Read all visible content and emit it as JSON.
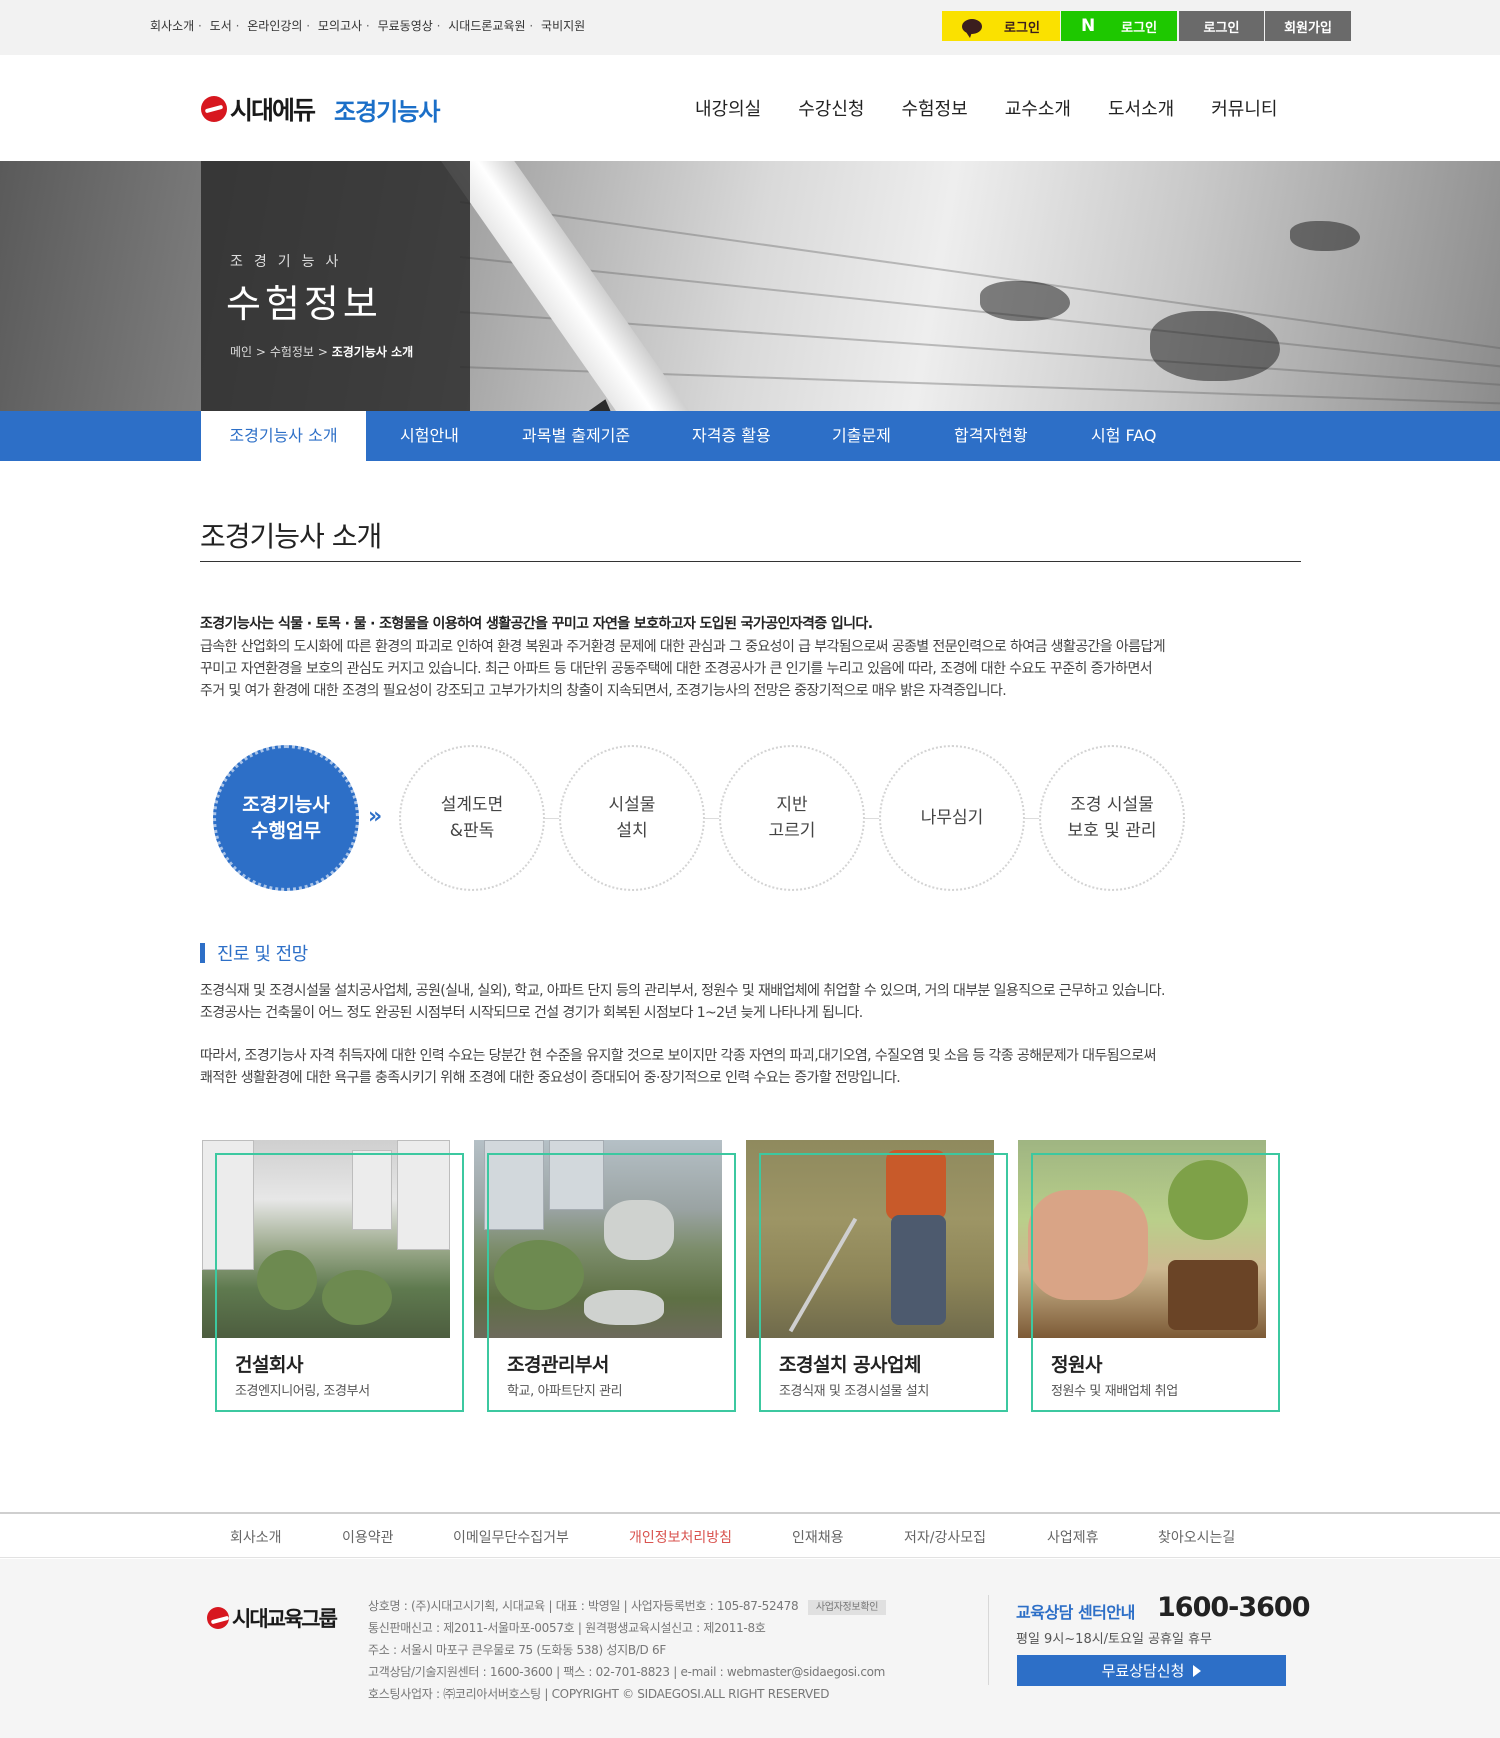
{
  "top_util": {
    "links": [
      "회사소개",
      "도서",
      "온라인강의",
      "모의고사",
      "무료동영상",
      "시대드론교육원",
      "국비지원"
    ],
    "kakao_login": "로그인",
    "naver_login": "로그인",
    "naver_mark": "N",
    "login": "로그인",
    "join": "회원가입"
  },
  "header": {
    "logo_text": "시대에듀",
    "logo_sub": "조경기능사",
    "nav": [
      "내강의실",
      "수강신청",
      "수험정보",
      "교수소개",
      "도서소개",
      "커뮤니티"
    ]
  },
  "hero": {
    "small_title": "조경기능사",
    "title": "수험정보",
    "breadcrumb_home": "메인",
    "breadcrumb_mid": "수험정보",
    "breadcrumb_current": "조경기능사 소개",
    "breadcrumb_sep": ">"
  },
  "subnav": {
    "tabs": [
      "조경기능사 소개",
      "시험안내",
      "과목별 출제기준",
      "자격증 활용",
      "기출문제",
      "합격자현황",
      "시험 FAQ"
    ]
  },
  "page": {
    "title": "조경기능사 소개",
    "intro_lead": "조경기능사는 식물 · 토목 · 물 · 조형물을 이용하여 생활공간을 꾸미고 자연을 보호하고자 도입된 국가공인자격증 입니다.",
    "intro_lines": [
      "급속한 산업화의 도시화에 따른 환경의 파괴로 인하여 환경 복원과 주거환경 문제에 대한 관심과 그 중요성이 급 부각됨으로써 공종별 전문인력으로 하여금 생활공간을 아름답게",
      "꾸미고 자연환경을 보호의 관심도 커지고 있습니다. 최근 아파트 등 대단위 공동주택에 대한 조경공사가 큰 인기를 누리고 있음에 따라, 조경에 대한 수요도 꾸준히 증가하면서",
      "주거 및 여가 환경에 대한 조경의 필요성이 강조되고 고부가가치의 창출이 지속되면서, 조경기능사의 전망은 중장기적으로 매우 밝은 자격증입니다."
    ]
  },
  "duties": {
    "main": "조경기능사\n수행업무",
    "arrow": "»",
    "items": [
      "설계도면\n&판독",
      "시설물\n설치",
      "지반\n고르기",
      "나무심기",
      "조경 시설물\n보호 및 관리"
    ]
  },
  "career": {
    "heading": "진로 및 전망",
    "para1": [
      "조경식재 및 조경시설물 설치공사업체, 공원(실내, 실외), 학교, 아파트 단지 등의 관리부서, 정원수 및 재배업체에 취업할 수 있으며, 거의 대부분 일용직으로 근무하고 있습니다.",
      "조경공사는 건축물이 어느 정도 완공된 시점부터 시작되므로 건설 경기가 회복된 시점보다 1~2년 늦게 나타나게 됩니다."
    ],
    "para2": [
      "따라서, 조경기능사 자격 취득자에 대한 인력 수요는 당분간 현 수준을 유지할 것으로 보이지만 각종 자연의 파괴,대기오염, 수질오염 및 소음 등 각종 공해문제가 대두됨으로써",
      "쾌적한 생활환경에 대한 욕구를 충족시키기 위해 조경에 대한 중요성이 증대되어 중·장기적으로 인력 수요는 증가할 전망입니다."
    ]
  },
  "cards": [
    {
      "title": "건설회사",
      "desc": "조경엔지니어링, 조경부서"
    },
    {
      "title": "조경관리부서",
      "desc": "학교, 아파트단지 관리"
    },
    {
      "title": "조경설치 공사업체",
      "desc": "조경식재 및 조경시설물 설치"
    },
    {
      "title": "정원사",
      "desc": "정원수 및 재배업체 취업"
    }
  ],
  "footer": {
    "links": [
      "회사소개",
      "이용약관",
      "이메일무단수집거부",
      "개인정보처리방침",
      "인재채용",
      "저자/강사모집",
      "사업제휴",
      "찾아오시는길"
    ],
    "logo_text": "시대교육그룹",
    "info_lines": [
      "상호명 : (주)시대고시기획, 시대교육 | 대표 : 박영일 | 사업자등록번호 : 105-87-52478",
      "통신판매신고 : 제2011-서울마포-0057호 | 원격평생교육시설신고 : 제2011-8호",
      "주소 : 서울시 마포구 큰우물로 75 (도화동 538) 성지B/D 6F",
      "고객상담/기술지원센터 : 1600-3600 | 팩스 : 02-701-8823 | e-mail : webmaster@sidaegosi.com",
      "호스팅사업자 : ㈜코리아서버호스팅 | COPYRIGHT © SIDAEGOSI.ALL RIGHT RESERVED"
    ],
    "badge": "사업자정보확인",
    "call_label": "교육상담 센터안내",
    "call_number": "1600-3600",
    "hours": "평일 9시~18시/토요일 공휴일 휴무",
    "consult_button": "무료상담신청"
  },
  "colors": {
    "primary": "#2d6fc7",
    "card_border": "#3cc8a0",
    "kakao": "#fae100",
    "naver": "#1ec800",
    "logo_red": "#d7171f"
  }
}
